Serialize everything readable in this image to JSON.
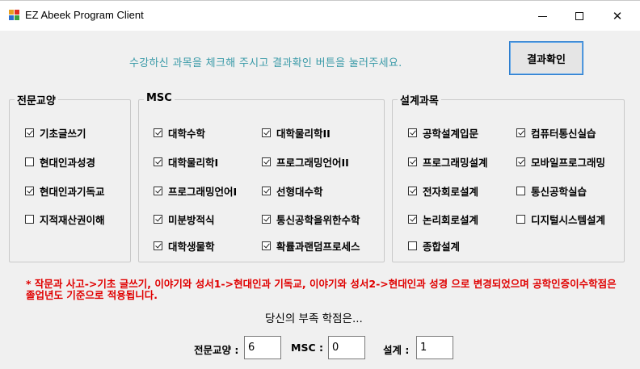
{
  "window": {
    "title": "EZ Abeek Program Client"
  },
  "instruction": "수강하신 과목을 체크해 주시고 결과확인 버튼을 눌러주세요.",
  "result_button": "결과확인",
  "groups": {
    "major_liberal": {
      "title": "전문교양",
      "items": [
        {
          "label": "기초글쓰기",
          "checked": true
        },
        {
          "label": "현대인과성경",
          "checked": false
        },
        {
          "label": "현대인과기독교",
          "checked": true
        },
        {
          "label": "지적재산권이해",
          "checked": false
        }
      ]
    },
    "msc": {
      "title": "MSC",
      "items": [
        {
          "label": "대학수학",
          "checked": true
        },
        {
          "label": "대학물리학II",
          "checked": true
        },
        {
          "label": "대학물리학I",
          "checked": true
        },
        {
          "label": "프로그래밍언어II",
          "checked": true
        },
        {
          "label": "프로그래밍언어I",
          "checked": true
        },
        {
          "label": "선형대수학",
          "checked": true
        },
        {
          "label": "미분방적식",
          "checked": true
        },
        {
          "label": "통신공학을위한수학",
          "checked": true
        },
        {
          "label": "대학생물학",
          "checked": true
        },
        {
          "label": "확률과랜덤프로세스",
          "checked": true
        }
      ]
    },
    "design": {
      "title": "설계과목",
      "items": [
        {
          "label": "공학설계입문",
          "checked": true
        },
        {
          "label": "컴퓨터통신실습",
          "checked": true
        },
        {
          "label": "프로그래밍설계",
          "checked": true
        },
        {
          "label": "모바일프로그래밍",
          "checked": true
        },
        {
          "label": "전자회로설계",
          "checked": true
        },
        {
          "label": "통신공학실습",
          "checked": false
        },
        {
          "label": "논리회로설계",
          "checked": true
        },
        {
          "label": "디지털시스템설계",
          "checked": false
        },
        {
          "label": "종합설계",
          "checked": false
        }
      ]
    }
  },
  "notice": "* 작문과 사고->기초 글쓰기, 이야기와 성서1->현대인과 기독교, 이야기와 성서2->현대인과 성경 으로 변경되었으며 공학인증이수학점은 졸업년도 기준으로 적용됩니다.",
  "lack_label": "당신의 부족 학점은...",
  "fields": {
    "major_liberal": {
      "label": "전문교양 :",
      "value": "6"
    },
    "msc": {
      "label": "MSC :",
      "value": "0"
    },
    "design": {
      "label": "설계 :",
      "value": "1"
    }
  },
  "colors": {
    "instruction": "#3a9aa8",
    "notice": "#e00000",
    "button_border": "#2f7fcf"
  }
}
